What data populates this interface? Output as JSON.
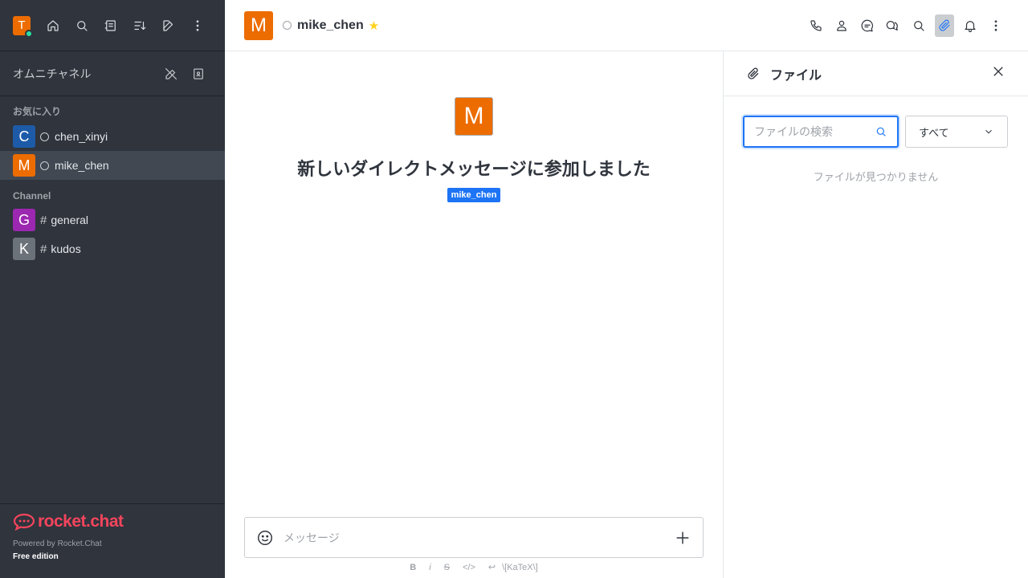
{
  "workspace": {
    "avatar_letter": "T"
  },
  "sidebar": {
    "omnichannel_label": "オムニチャネル",
    "favorites_title": "お気に入り",
    "favorites": [
      {
        "letter": "C",
        "name": "chen_xinyi",
        "color": "#1d5ba8"
      },
      {
        "letter": "M",
        "name": "mike_chen",
        "color": "#ec6c00"
      }
    ],
    "channel_title": "Channel",
    "channels": [
      {
        "letter": "G",
        "name": "general",
        "color": "#9c27b0"
      },
      {
        "letter": "K",
        "name": "kudos",
        "color": "#6c727a"
      }
    ],
    "footer": {
      "logo_text": "rocket.chat",
      "powered": "Powered by Rocket.Chat",
      "edition": "Free edition"
    }
  },
  "header": {
    "avatar_letter": "M",
    "username": "mike_chen",
    "star": "★"
  },
  "room": {
    "avatar_letter": "M",
    "welcome_text": "新しいダイレクトメッセージに参加しました",
    "badge": "mike_chen",
    "composer_placeholder": "メッセージ",
    "formatting": [
      "B",
      "i",
      "S",
      "</>",
      "↩",
      "\\[KaTeX\\]"
    ]
  },
  "files_panel": {
    "title": "ファイル",
    "search_placeholder": "ファイルの検索",
    "filter_value": "すべて",
    "empty_text": "ファイルが見つかりません"
  },
  "colors": {
    "accent": "#1d74f5",
    "brand": "#f5455c",
    "sidebar_bg": "#2f343d"
  }
}
